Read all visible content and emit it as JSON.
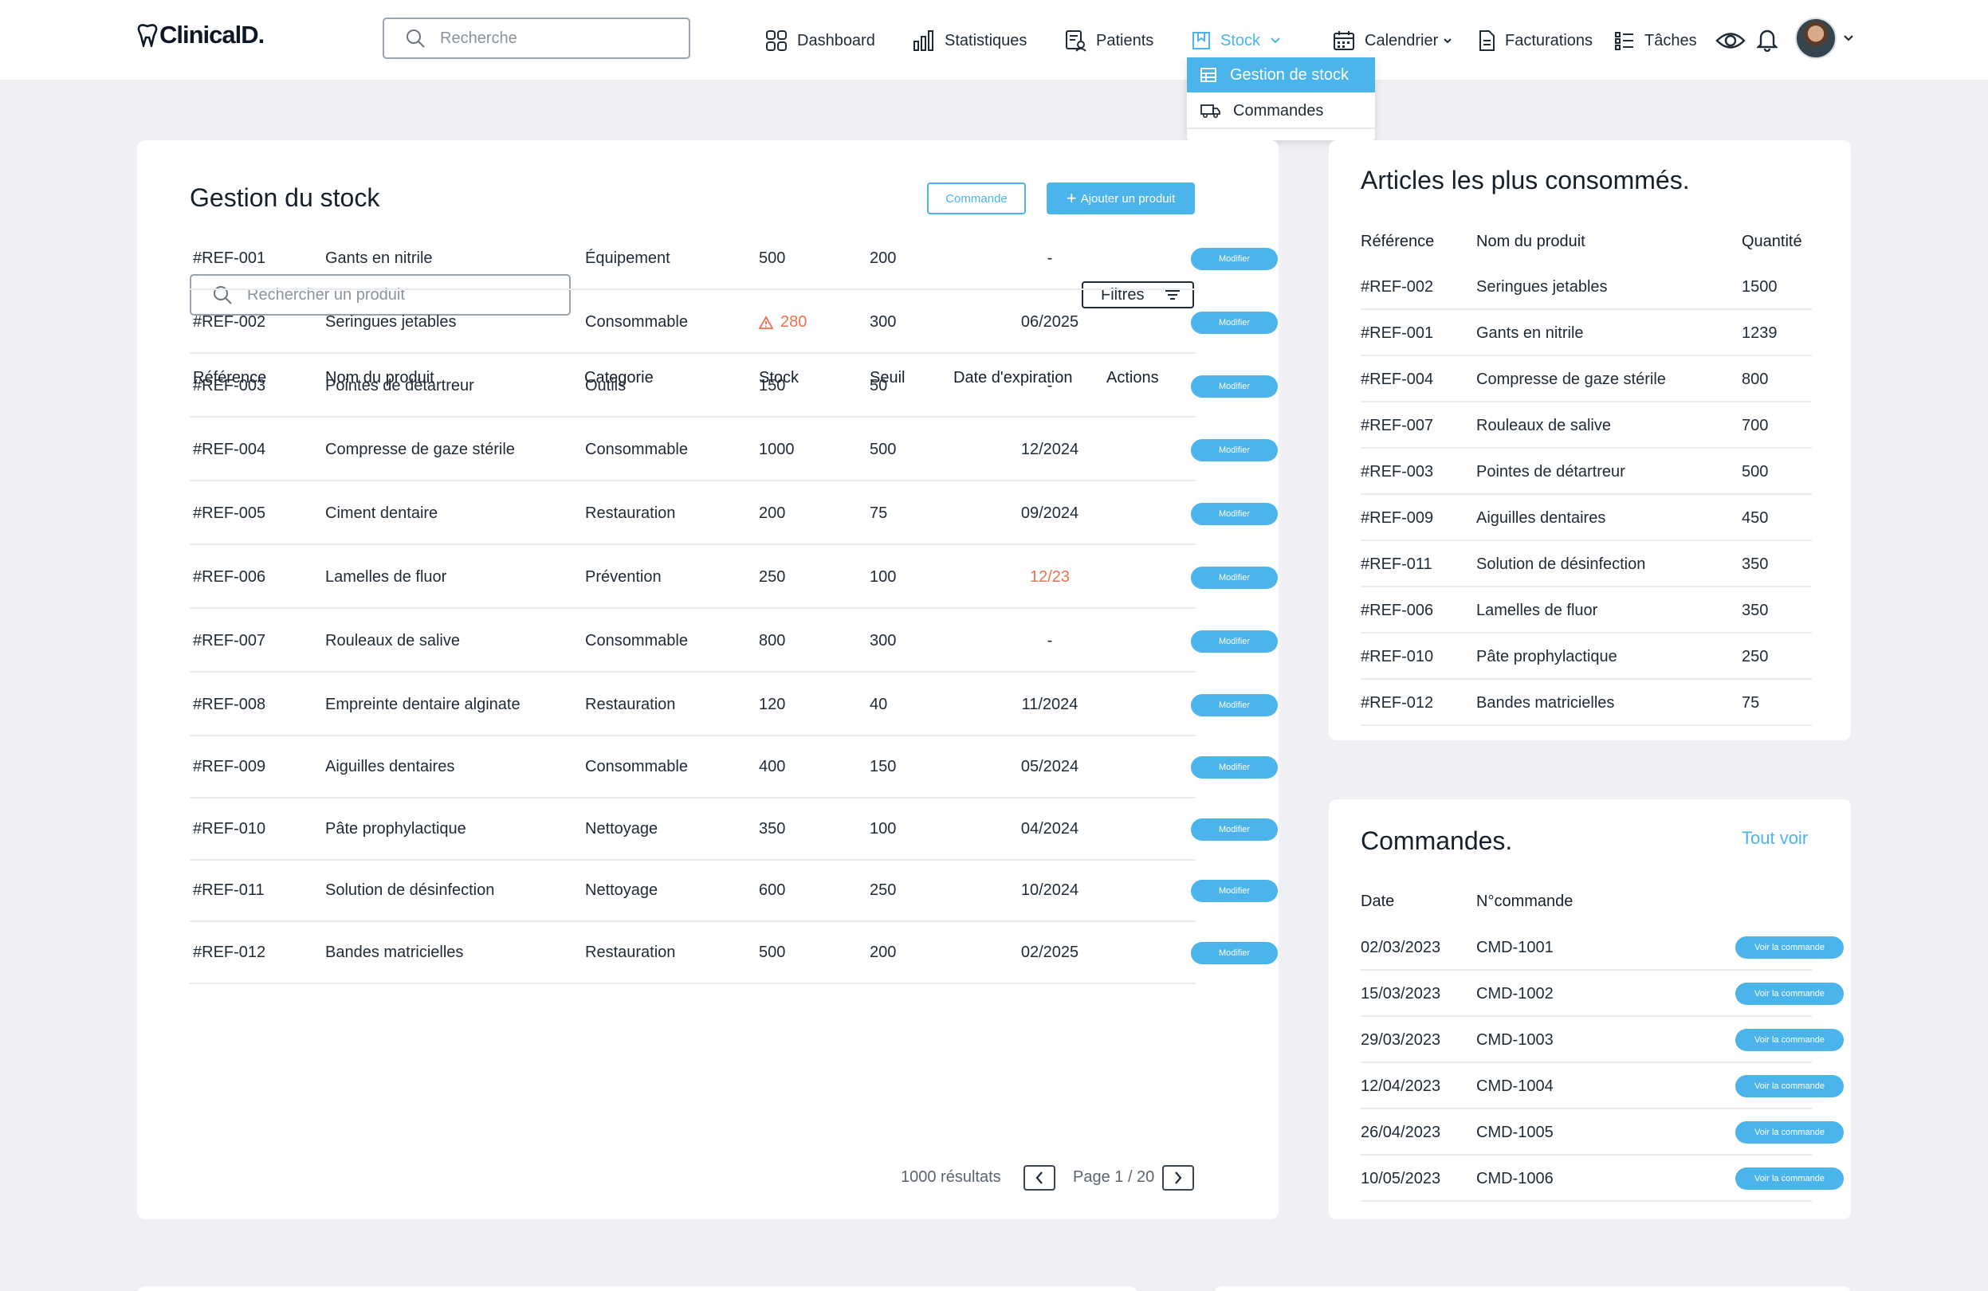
{
  "app": {
    "logo": "ClinicalD."
  },
  "header": {
    "search_placeholder": "Recherche",
    "nav": [
      {
        "label": "Dashboard",
        "icon": "grid-icon"
      },
      {
        "label": "Statistiques",
        "icon": "bar-chart-icon"
      },
      {
        "label": "Patients",
        "icon": "patients-icon"
      },
      {
        "label": "Stock",
        "icon": "stock-icon",
        "active": true
      },
      {
        "label": "Calendrier",
        "icon": "calendar-icon"
      },
      {
        "label": "Facturations",
        "icon": "invoice-icon"
      },
      {
        "label": "Tâches",
        "icon": "list-icon"
      }
    ],
    "stock_menu": [
      {
        "label": "Gestion de stock",
        "selected": true
      },
      {
        "label": "Commandes"
      }
    ]
  },
  "colors": {
    "accent": "#4bb4ea",
    "warning": "#ef6f4f",
    "background": "#eef0f3"
  },
  "stock": {
    "title": "Gestion du stock",
    "btn_order": "Commande",
    "btn_add": "Ajouter un produit",
    "search_placeholder": "Rechercher un produit",
    "filters_label": "Filtres",
    "columns": [
      "Référence",
      "Nom du produit",
      "Categorie",
      "Stock",
      "Seuil",
      "Date d'expiration",
      "Actions"
    ],
    "action_label": "Modifier",
    "rows": [
      {
        "ref": "#REF-001",
        "name": "Gants en nitrile",
        "category": "Équipement",
        "stock": "500",
        "threshold": "200",
        "expiry": "-",
        "low": false,
        "expired": false
      },
      {
        "ref": "#REF-002",
        "name": "Seringues jetables",
        "category": "Consommable",
        "stock": "280",
        "threshold": "300",
        "expiry": "06/2025",
        "low": true,
        "expired": false
      },
      {
        "ref": "#REF-003",
        "name": "Pointes de détartreur",
        "category": "Outils",
        "stock": "150",
        "threshold": "50",
        "expiry": "-",
        "low": false,
        "expired": false
      },
      {
        "ref": "#REF-004",
        "name": "Compresse de gaze stérile",
        "category": "Consommable",
        "stock": "1000",
        "threshold": "500",
        "expiry": "12/2024",
        "low": false,
        "expired": false
      },
      {
        "ref": "#REF-005",
        "name": "Ciment dentaire",
        "category": "Restauration",
        "stock": "200",
        "threshold": "75",
        "expiry": "09/2024",
        "low": false,
        "expired": false
      },
      {
        "ref": "#REF-006",
        "name": "Lamelles de fluor",
        "category": "Prévention",
        "stock": "250",
        "threshold": "100",
        "expiry": "12/23",
        "low": false,
        "expired": true
      },
      {
        "ref": "#REF-007",
        "name": "Rouleaux de salive",
        "category": "Consommable",
        "stock": "800",
        "threshold": "300",
        "expiry": "-",
        "low": false,
        "expired": false
      },
      {
        "ref": "#REF-008",
        "name": "Empreinte dentaire alginate",
        "category": "Restauration",
        "stock": "120",
        "threshold": "40",
        "expiry": "11/2024",
        "low": false,
        "expired": false
      },
      {
        "ref": "#REF-009",
        "name": "Aiguilles dentaires",
        "category": "Consommable",
        "stock": "400",
        "threshold": "150",
        "expiry": "05/2024",
        "low": false,
        "expired": false
      },
      {
        "ref": "#REF-010",
        "name": "Pâte prophylactique",
        "category": "Nettoyage",
        "stock": "350",
        "threshold": "100",
        "expiry": "04/2024",
        "low": false,
        "expired": false
      },
      {
        "ref": "#REF-011",
        "name": "Solution de désinfection",
        "category": "Nettoyage",
        "stock": "600",
        "threshold": "250",
        "expiry": "10/2024",
        "low": false,
        "expired": false
      },
      {
        "ref": "#REF-012",
        "name": "Bandes matricielles",
        "category": "Restauration",
        "stock": "500",
        "threshold": "200",
        "expiry": "02/2025",
        "low": false,
        "expired": false
      }
    ],
    "results": "1000 résultats",
    "page": "Page 1 / 20"
  },
  "top_items": {
    "title": "Articles les plus consommés.",
    "columns": [
      "Référence",
      "Nom du produit",
      "Quantité"
    ],
    "rows": [
      {
        "ref": "#REF-002",
        "name": "Seringues jetables",
        "qty": "1500"
      },
      {
        "ref": "#REF-001",
        "name": "Gants en nitrile",
        "qty": "1239"
      },
      {
        "ref": "#REF-004",
        "name": "Compresse de gaze stérile",
        "qty": "800"
      },
      {
        "ref": "#REF-007",
        "name": "Rouleaux de salive",
        "qty": "700"
      },
      {
        "ref": "#REF-003",
        "name": "Pointes de détartreur",
        "qty": "500"
      },
      {
        "ref": "#REF-009",
        "name": "Aiguilles dentaires",
        "qty": "450"
      },
      {
        "ref": "#REF-011",
        "name": "Solution de désinfection",
        "qty": "350"
      },
      {
        "ref": "#REF-006",
        "name": "Lamelles de fluor",
        "qty": "350"
      },
      {
        "ref": "#REF-010",
        "name": "Pâte prophylactique",
        "qty": "250"
      },
      {
        "ref": "#REF-012",
        "name": "Bandes matricielles",
        "qty": "75"
      }
    ]
  },
  "orders": {
    "title": "Commandes.",
    "see_all": "Tout voir",
    "columns": [
      "Date",
      "N°commande"
    ],
    "action_label": "Voir la commande",
    "rows": [
      {
        "date": "02/03/2023",
        "number": "CMD-1001"
      },
      {
        "date": "15/03/2023",
        "number": "CMD-1002"
      },
      {
        "date": "29/03/2023",
        "number": "CMD-1003"
      },
      {
        "date": "12/04/2023",
        "number": "CMD-1004"
      },
      {
        "date": "26/04/2023",
        "number": "CMD-1005"
      },
      {
        "date": "10/05/2023",
        "number": "CMD-1006"
      }
    ]
  }
}
